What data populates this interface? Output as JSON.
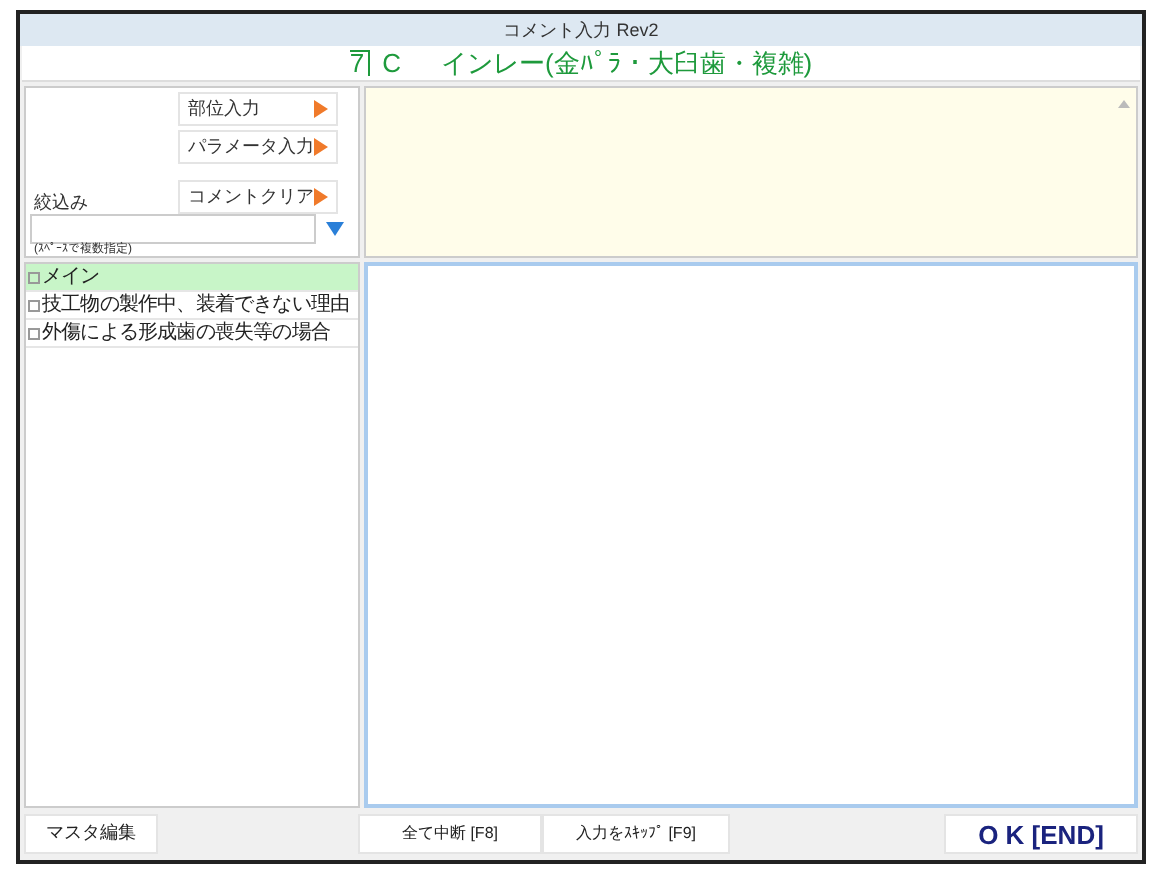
{
  "window": {
    "title": "コメント入力 Rev2"
  },
  "header": {
    "tooth": "7",
    "code": "C",
    "description": "インレー(金ﾊﾟﾗ・大臼歯・複雑)"
  },
  "side_buttons": [
    {
      "label": "部位入力"
    },
    {
      "label": "パラメータ入力"
    },
    {
      "label": "コメントクリア"
    }
  ],
  "filter": {
    "label": "絞込み",
    "hint": "(ｽﾍﾟｰｽで複数指定)"
  },
  "items": [
    {
      "label": "メイン",
      "selected": true
    },
    {
      "label": "技工物の製作中、装着できない理由",
      "selected": false
    },
    {
      "label": "外傷による形成歯の喪失等の場合",
      "selected": false
    }
  ],
  "footer": {
    "master": "マスタ編集",
    "cancel_all": "全て中断 [F8]",
    "skip": "入力をｽｷｯﾌﾟ [F9]",
    "ok": "O K [END]"
  }
}
